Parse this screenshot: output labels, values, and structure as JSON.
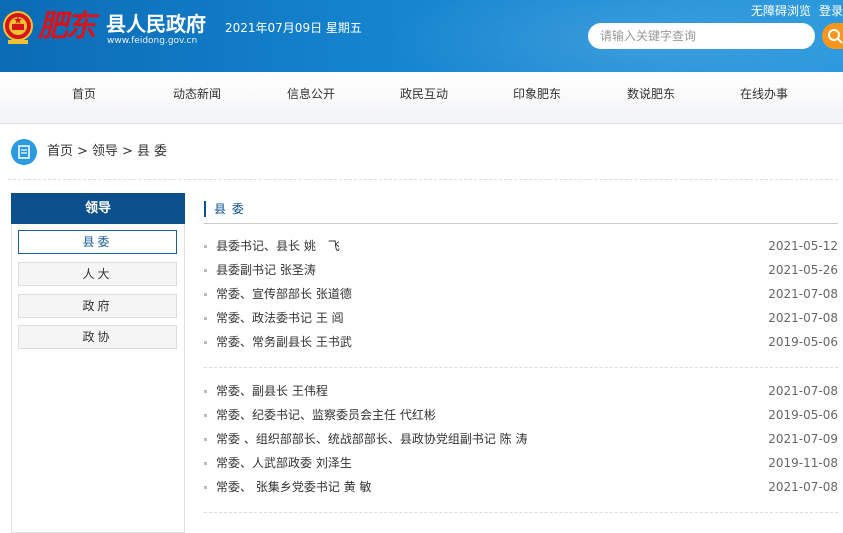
{
  "header": {
    "calligraphy": "肥东",
    "site_name": "县人民政府",
    "site_url": "www.feidong.gov.cn",
    "date": "2021年07月09日 星期五",
    "accessibility_link": "无障碍浏览",
    "login_link": "登录",
    "search_placeholder": "请输入关键字查询"
  },
  "nav": [
    "首页",
    "动态新闻",
    "信息公开",
    "政民互动",
    "印象肥东",
    "数说肥东",
    "在线办事"
  ],
  "breadcrumb": [
    "首页",
    ">",
    "领导",
    ">",
    "县 委"
  ],
  "sidebar": {
    "title": "领导",
    "items": [
      "县委",
      "人大",
      "政府",
      "政协"
    ]
  },
  "section": {
    "title": "县 委",
    "group1": [
      {
        "title": "县委书记、县长 姚　飞",
        "date": "2021-05-12"
      },
      {
        "title": "县委副书记 张圣涛",
        "date": "2021-05-26"
      },
      {
        "title": "常委、宣传部部长 张道德",
        "date": "2021-07-08"
      },
      {
        "title": "常委、政法委书记 王 阊",
        "date": "2021-07-08"
      },
      {
        "title": "常委、常务副县长 王书武",
        "date": "2019-05-06"
      }
    ],
    "group2": [
      {
        "title": "常委、副县长 王伟程",
        "date": "2021-07-08"
      },
      {
        "title": "常委、纪委书记、监察委员会主任 代红彬",
        "date": "2019-05-06"
      },
      {
        "title": "常委 、组织部部长、统战部部长、县政协党组副书记 陈 涛",
        "date": "2021-07-09"
      },
      {
        "title": "常委、人武部政委 刘泽生",
        "date": "2019-11-08"
      },
      {
        "title": "常委、 张集乡党委书记 黄 敏",
        "date": "2021-07-08"
      }
    ]
  },
  "colors": {
    "header_blue": "#1584cf",
    "sidebar_head": "#0b4f8c",
    "search_button": "#f7951d",
    "calligraphy_red": "#d8141b"
  }
}
